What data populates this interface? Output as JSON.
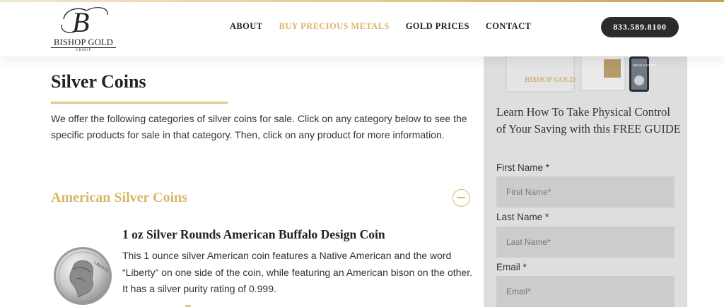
{
  "brand": {
    "name": "BISHOP GOLD",
    "sub": "GROUP",
    "monogram": "B"
  },
  "nav": {
    "items": [
      {
        "label": "ABOUT"
      },
      {
        "label": "BUY PRECIOUS METALS"
      },
      {
        "label": "GOLD PRICES"
      },
      {
        "label": "CONTACT"
      }
    ],
    "active_index": 1
  },
  "phone": "833.589.8100",
  "page": {
    "title": "Silver Coins",
    "intro": "We offer the following categories of silver coins for sale. Click on any category below to see the specific products for sale in that category. Then, click on any product for more information."
  },
  "category": {
    "title": "American Silver Coins",
    "product": {
      "title": "1 oz Silver Rounds American Buffalo Design Coin",
      "description": "This 1 ounce silver American coin features a Native American and the word “Liberty” on one side of the coin, while featuring an American bison on the other. It has a silver purity rating of 0.999.",
      "coin_text": "LIBERTY"
    }
  },
  "sidebar": {
    "guide_cover_brand": "BISHOP GOLD",
    "guide_phone_text": "METALS GUIDE",
    "heading": "Learn How To Take Physical Control of Your Saving with this FREE GUIDE",
    "fields": [
      {
        "label": "First Name *",
        "placeholder": "First Name*"
      },
      {
        "label": "Last Name *",
        "placeholder": "Last Name*"
      },
      {
        "label": "Email *",
        "placeholder": "Email*"
      }
    ]
  },
  "colors": {
    "accent_gold": "#d9b769",
    "phone_button": "#2b2b2b",
    "sidebar_bg": "#dedede",
    "input_bg": "#cccccc"
  }
}
